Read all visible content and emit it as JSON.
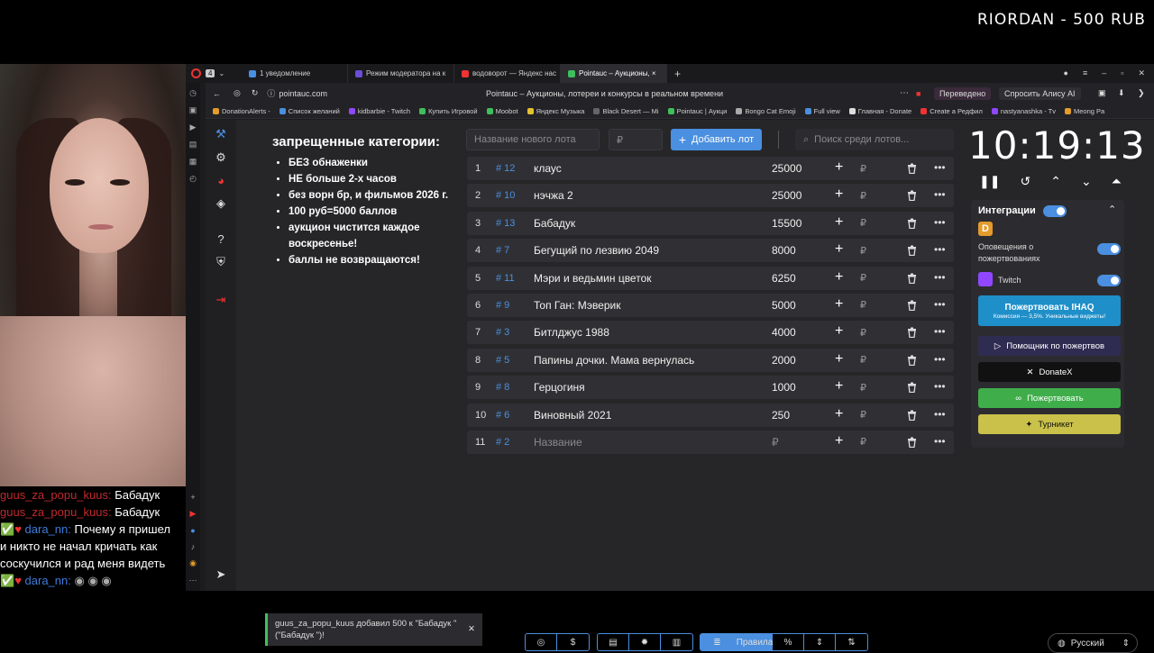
{
  "overlay": {
    "title": "RIORDAN - 500 RUB"
  },
  "chat": {
    "lines": [
      {
        "nick": "guus_za_popu_kuus:",
        "msg": "Бабадук"
      },
      {
        "nick": "guus_za_popu_kuus:",
        "msg": "Бабадук"
      },
      {
        "nick": "dara_nn:",
        "msg": "Почему я пришел"
      },
      {
        "nick": "",
        "msg": "и никто не начал кричать как"
      },
      {
        "nick": "",
        "msg": "соскучился и рад меня видеть"
      },
      {
        "nick": "dara_nn:",
        "msg": ""
      }
    ]
  },
  "browser": {
    "tabs": [
      {
        "label": "1 уведомление"
      },
      {
        "label": "Режим модератора на к"
      },
      {
        "label": "водоворот — Яндекс нас"
      },
      {
        "label": "Pointauc – Аукционы, ×"
      }
    ],
    "url": "pointauc.com",
    "page_title": "Pointauc – Аукционы, лотереи и конкурсы в реальном времени",
    "translated": "Переведено",
    "ask_alice": "Спросить Алису AI",
    "bookmarks": [
      "DonationAlerts -",
      "Список желаний",
      "kidbarbie - Twitch",
      "Купить Игровой",
      "Moobot",
      "Яндекс Музыка",
      "Black Desert — Mi",
      "Pointauc | Аукци",
      "Bongo Cat Emoji",
      "Full view",
      "Главная - Donate",
      "Create a Редфил",
      "nastyanashka - Tv",
      "Meong Pa"
    ]
  },
  "rules": {
    "title": "запрещенные категории:",
    "items": [
      "БЕЗ обнаженки",
      "НЕ больше 2-х часов",
      "без ворн бр, и фильмов 2026 г.",
      "100 руб=5000 баллов",
      "аукцион чистится каждое воскресенье!",
      "баллы не возвращаются!"
    ]
  },
  "form": {
    "lot_name_placeholder": "Название нового лота",
    "amount_placeholder": "₽",
    "add_label": "Добавить лот",
    "search_placeholder": "Поиск среди лотов..."
  },
  "lots": [
    {
      "n": "1",
      "id": "# 12",
      "name": "клаус",
      "amount": "25000"
    },
    {
      "n": "2",
      "id": "# 10",
      "name": "нэчжа 2",
      "amount": "25000"
    },
    {
      "n": "3",
      "id": "# 13",
      "name": "Бабадук",
      "amount": "15500"
    },
    {
      "n": "4",
      "id": "# 7",
      "name": "Бегущий по лезвию 2049",
      "amount": "8000"
    },
    {
      "n": "5",
      "id": "# 11",
      "name": "Мэри и ведьмин цветок",
      "amount": "6250"
    },
    {
      "n": "6",
      "id": "# 9",
      "name": "Топ Ган: Мэверик",
      "amount": "5000"
    },
    {
      "n": "7",
      "id": "# 3",
      "name": "Битлджус 1988",
      "amount": "4000"
    },
    {
      "n": "8",
      "id": "# 5",
      "name": "Папины дочки. Мама вернулась",
      "amount": "2000"
    },
    {
      "n": "9",
      "id": "# 8",
      "name": "Герцогиня",
      "amount": "1000"
    },
    {
      "n": "10",
      "id": "# 6",
      "name": "Виновный 2021",
      "amount": "250"
    },
    {
      "n": "11",
      "id": "# 2",
      "name": "Название",
      "amount": "₽",
      "placeholder": true
    }
  ],
  "lot_currency": "₽",
  "timer": {
    "time": "10:19:13"
  },
  "integrations": {
    "title": "Интеграции",
    "donation_alerts": "Оповещения о пожертвованиях",
    "twitch": "Twitch",
    "ihaq": "Пожертвовать IHAQ",
    "ihaq_sub": "Комиссия — 3,5%. Уникальные виджеты!",
    "helper": "Помощник по пожертвов",
    "donatex": "DonateX",
    "donate": "Пожертвовать",
    "turniket": "Турникет"
  },
  "toast": {
    "text": "guus_za_popu_kuus добавил 500 к \"Бабадук \" (\"Бабадук \")!"
  },
  "bottom": {
    "rules_label": "Правила",
    "language": "Русский"
  },
  "colors": {
    "accent": "#4a8fe0",
    "chat_nick": "#c0292d",
    "success": "#3fbf5c",
    "turniket": "#c9c14a"
  }
}
